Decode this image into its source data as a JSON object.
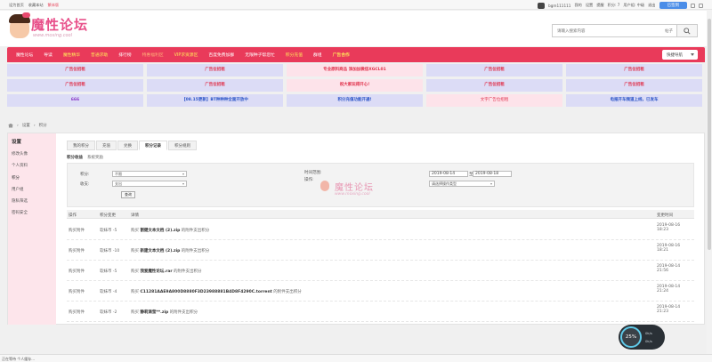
{
  "topbar": {
    "left": [
      "设为首页",
      "收藏本站",
      "繁体版"
    ],
    "right": {
      "username": "bgm111111",
      "links": [
        "我的",
        "设置",
        "提醒",
        "积分: 7",
        "用户组: 中级",
        "退出"
      ],
      "sign": "已签到"
    }
  },
  "logo": {
    "text": "魔性论坛",
    "url": "www.moxing.cool"
  },
  "search": {
    "placeholder": "请输入搜索内容",
    "scope": "帖子"
  },
  "nav": {
    "items": [
      {
        "label": "魔性论坛",
        "style": "normal"
      },
      {
        "label": "导读",
        "style": "normal"
      },
      {
        "label": "魔性精华",
        "style": "yellow"
      },
      {
        "label": "普通求助",
        "style": "yellow"
      },
      {
        "label": "排行榜",
        "style": "normal"
      },
      {
        "label": "特惠福利区",
        "style": "orange"
      },
      {
        "label": "VIP求资源区",
        "style": "yellow"
      },
      {
        "label": "百度免费加群",
        "style": "normal"
      },
      {
        "label": "无限种子帮您忙",
        "style": "normal"
      },
      {
        "label": "积分充值",
        "style": "yellow"
      },
      {
        "label": "群组",
        "style": "normal"
      },
      {
        "label": "广告合作",
        "style": "yellow-bold"
      }
    ],
    "quicknav": "快捷导航"
  },
  "ads": [
    [
      {
        "text": "广告位招租",
        "bg": "blue",
        "color": "red"
      },
      {
        "text": "广告位招租",
        "bg": "blue",
        "color": "red"
      },
      {
        "text": "专业原料商品 添加加微信XGCL01",
        "bg": "pink",
        "color": "red"
      },
      {
        "text": "广告位招租",
        "bg": "blue",
        "color": "red"
      },
      {
        "text": "广告位招租",
        "bg": "blue",
        "color": "red"
      }
    ],
    [
      {
        "text": "广告位招租",
        "bg": "blue",
        "color": "red"
      },
      {
        "text": "广告位招租",
        "bg": "blue",
        "color": "red"
      },
      {
        "text": "祝大家玩得开心!",
        "bg": "pink",
        "color": "red"
      },
      {
        "text": "广告位招租",
        "bg": "blue",
        "color": "red"
      },
      {
        "text": "广告位招租",
        "bg": "blue",
        "color": "red"
      }
    ],
    [
      {
        "text": "666",
        "bg": "blue",
        "color": "purple"
      },
      {
        "text": "【08.15更新】BT种种种全面开放中",
        "bg": "blue",
        "color": "blue"
      },
      {
        "text": "积分充值功能开通!",
        "bg": "blue",
        "color": "blue"
      },
      {
        "text": "文字广告位招租",
        "bg": "pink",
        "color": "plain"
      },
      {
        "text": "电报开车频道上线，已发车",
        "bg": "blue",
        "color": "blue"
      }
    ]
  ],
  "breadcrumb": [
    "设置",
    "积分"
  ],
  "sidebar": {
    "title": "设置",
    "items": [
      "修改头像",
      "个人资料",
      "积分",
      "用户组",
      "隐私筛选",
      "密码安全"
    ]
  },
  "tabs": [
    "我的积分",
    "充值",
    "兑换",
    "积分记录",
    "积分规则"
  ],
  "subtabs": [
    "积分收益",
    "系统奖励"
  ],
  "filter": {
    "credit_label": "积分:",
    "credit_value": "不限",
    "direction_label": "收支:",
    "direction_value": "支出",
    "query": "查询",
    "time_label": "时间范围:",
    "op_label": "操作:",
    "date_from": "2019-08-14",
    "date_to_label": "至",
    "date_to": "2019-08-18",
    "op_value": "请选择操作类型"
  },
  "table": {
    "headers": [
      "操作",
      "积分变更",
      "详情",
      "变更时间"
    ],
    "rows": [
      {
        "op": "购买附件",
        "change": "软妹币 -5",
        "prefix": "购买 ",
        "name": "割健文本文档 (2).zip",
        "suffix": " 的附件支出积分",
        "time": "2019-08-16 18:23"
      },
      {
        "op": "购买附件",
        "change": "软妹币 -10",
        "prefix": "购买 ",
        "name": "新建文本文档 (2).zip",
        "suffix": " 的附件支出积分",
        "time": "2019-08-16 18:21"
      },
      {
        "op": "购买附件",
        "change": "软妹币 -5",
        "prefix": "购买 ",
        "name": "我爱魔性论坛.rar",
        "suffix": " 的附件支出积分",
        "time": "2019-08-14 21:56"
      },
      {
        "op": "购买附件",
        "change": "软妹币 -4",
        "prefix": "购买 ",
        "name": "C11281AAE9A800D8880F3D23988881B4D8F4290C.torrent",
        "suffix": " 的附件支出积分",
        "time": "2019-08-14 21:24"
      },
      {
        "op": "购买附件",
        "change": "软妹币 -2",
        "prefix": "购买 ",
        "name": "静莉滴莹**.zip",
        "suffix": " 的附件支出积分",
        "time": "2019-08-14 21:23"
      }
    ]
  },
  "float_widget": {
    "percent": "25%",
    "stat1": "0k/s",
    "stat2": "0k/s"
  },
  "statusbar": "正在等待 个人缓存..."
}
